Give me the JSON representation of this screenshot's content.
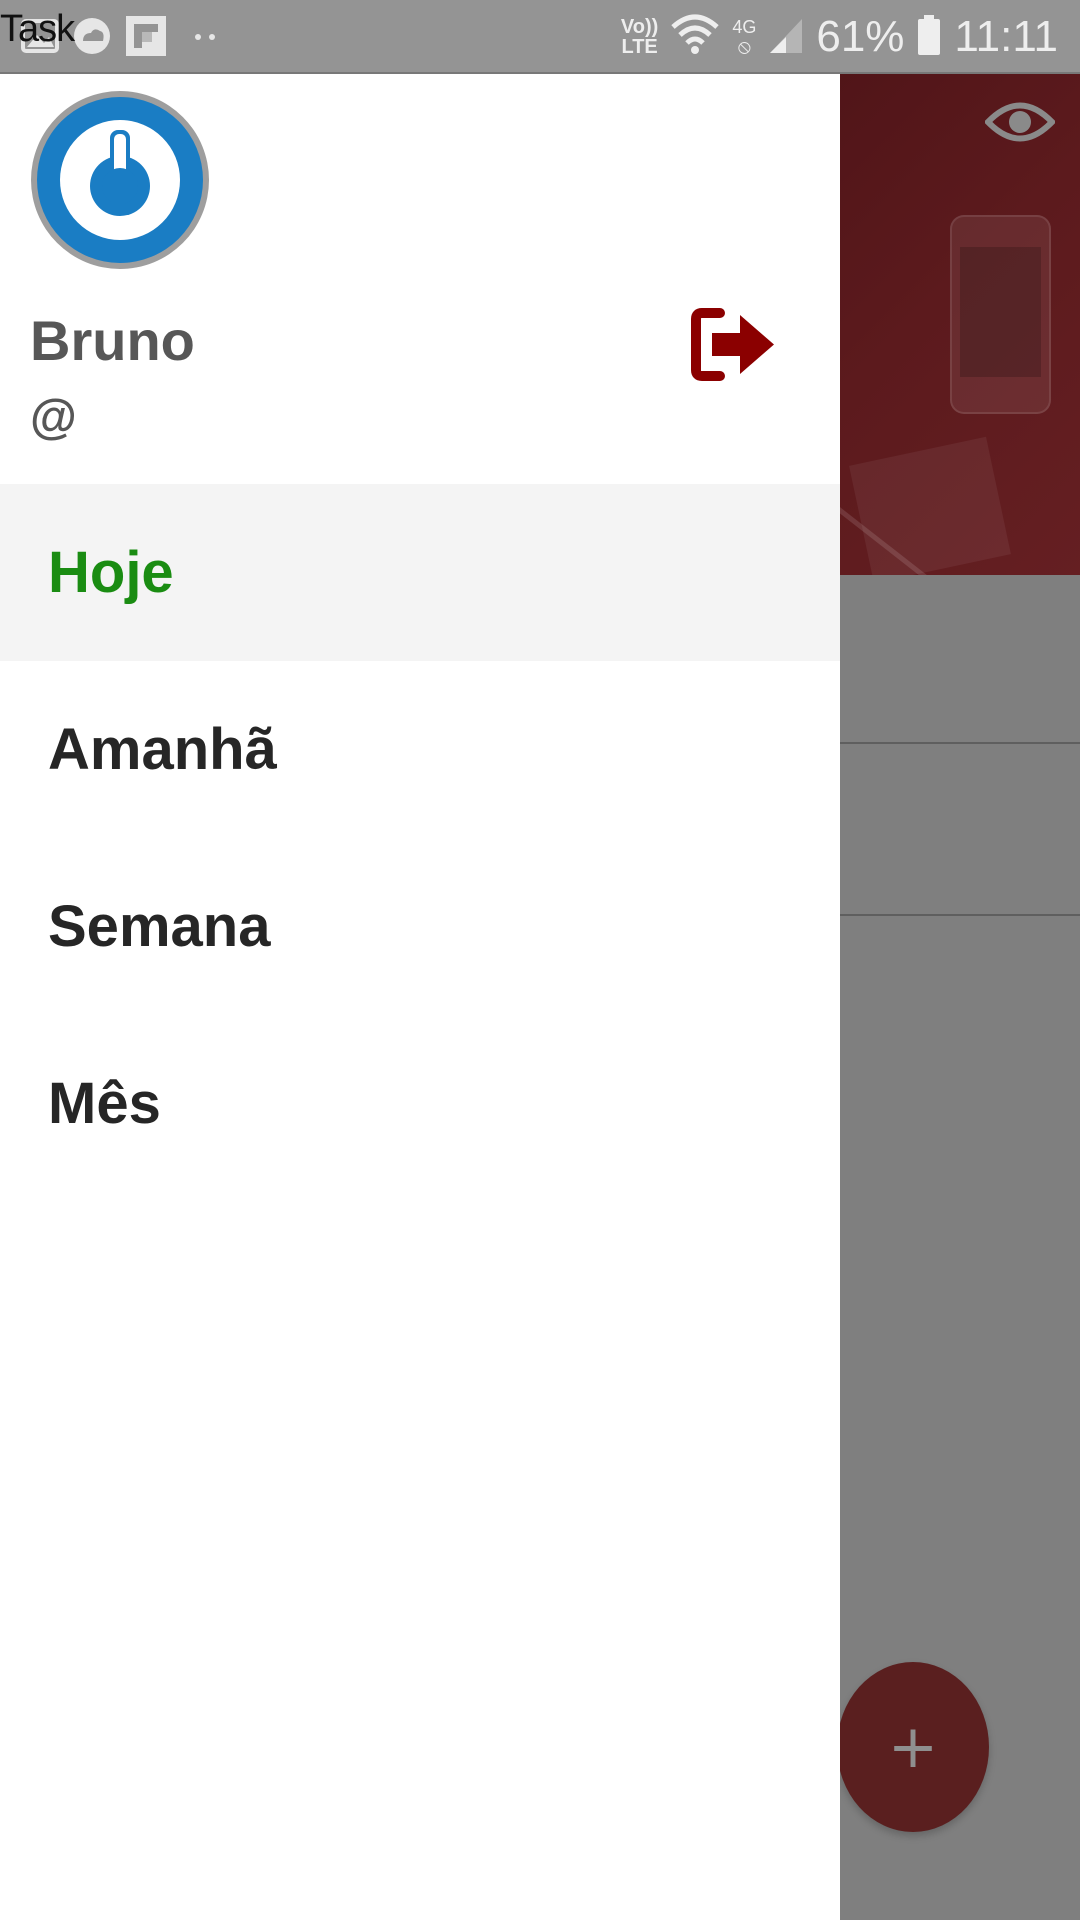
{
  "status_bar": {
    "app_title": "Task",
    "network_label": "Vo)) LTE",
    "signal_label": "4G",
    "battery_percent": "61%",
    "time": "11:11",
    "notification_icons": [
      "image-icon",
      "cloud-icon",
      "flipboard-icon",
      "more-dots-icon"
    ]
  },
  "drawer": {
    "user": {
      "name": "Bruno",
      "handle": "@"
    },
    "menu_items": [
      {
        "label": "Hoje",
        "active": true
      },
      {
        "label": "Amanhã",
        "active": false
      },
      {
        "label": "Semana",
        "active": false
      },
      {
        "label": "Mês",
        "active": false
      }
    ]
  },
  "background_app": {
    "fab_label": "+"
  },
  "colors": {
    "active_menu": "#1a8c12",
    "logout_icon": "#8b0000",
    "avatar_ring": "#1a7dc4",
    "hero_bg": "#4b1216"
  }
}
